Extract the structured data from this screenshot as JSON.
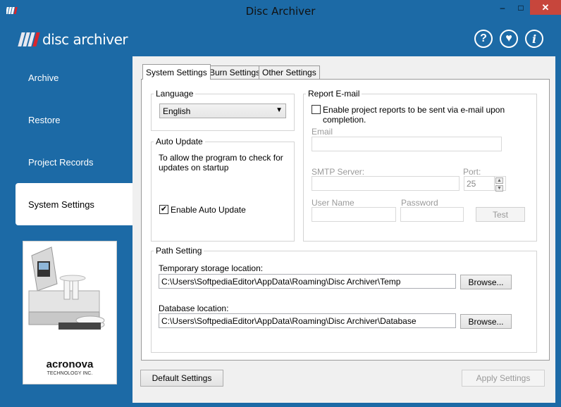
{
  "window": {
    "title": "Disc Archiver",
    "min": "–",
    "max": "□",
    "close": "✕"
  },
  "header": {
    "logo_text": "disc archiver",
    "help_icon": "?",
    "heart_icon": "♥",
    "info_icon": "i"
  },
  "sidebar": {
    "items": [
      {
        "label": "Archive"
      },
      {
        "label": "Restore"
      },
      {
        "label": "Project Records"
      },
      {
        "label": "System Settings"
      }
    ],
    "promo_brand": "acronova",
    "promo_sub": "TECHNOLOGY INC."
  },
  "tabs": [
    {
      "label": "System Settings"
    },
    {
      "label": "Burn Settings"
    },
    {
      "label": "Other Settings"
    }
  ],
  "language": {
    "group": "Language",
    "value": "English"
  },
  "auto_update": {
    "group": "Auto Update",
    "description": "To allow the program to check for updates on startup",
    "checkbox_label": "Enable Auto Update",
    "checked": true
  },
  "report_email": {
    "group": "Report E-mail",
    "checkbox_label": "Enable project reports to be sent via e-mail upon completion.",
    "email_label": "Email",
    "smtp_label": "SMTP Server:",
    "port_label": "Port:",
    "port_value": "25",
    "user_label": "User Name",
    "password_label": "Password",
    "test_button": "Test"
  },
  "path_setting": {
    "group": "Path Setting",
    "temp_label": "Temporary storage location:",
    "temp_value": "C:\\Users\\SoftpediaEditor\\AppData\\Roaming\\Disc Archiver\\Temp",
    "db_label": "Database location:",
    "db_value": "C:\\Users\\SoftpediaEditor\\AppData\\Roaming\\Disc Archiver\\Database",
    "browse_label": "Browse..."
  },
  "footer": {
    "default_button": "Default Settings",
    "apply_button": "Apply Settings"
  },
  "colors": {
    "accent": "#1c6aa6",
    "close": "#c7463c",
    "brand_red": "#d9262c"
  }
}
